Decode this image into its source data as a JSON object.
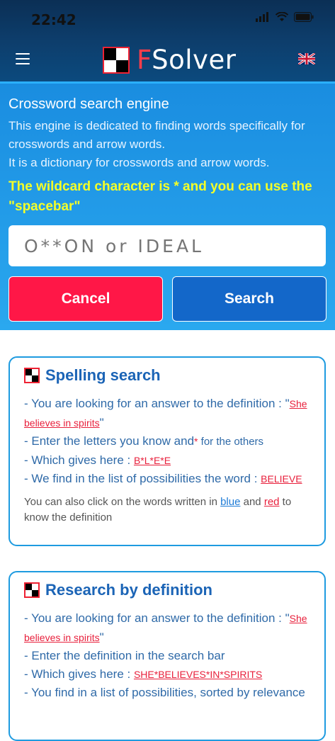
{
  "status_bar": {
    "time": "22:42"
  },
  "header": {
    "brand_first": "F",
    "brand_rest": "Solver",
    "language_flag": "uk-flag-icon"
  },
  "hero": {
    "title": "Crossword search engine",
    "description_1": "This engine is dedicated to finding words specifically for crosswords and arrow words.",
    "description_2": "It is a dictionary for crosswords and arrow words.",
    "wildcard_note": "The wildcard character is * and you can use the \"spacebar\""
  },
  "search": {
    "placeholder": "O**ON or IDEAL",
    "value": ""
  },
  "buttons": {
    "cancel": "Cancel",
    "search": "Search"
  },
  "cards": {
    "spelling": {
      "title": "Spelling search",
      "line1_a": "- You are looking for an answer to the definition : \"",
      "line1_link": "She believes in spirits",
      "line1_b": "\"",
      "line2_a": "- Enter the letters you know and",
      "line2_star": "*",
      "line2_b": " for the others",
      "line3_a": "- Which gives here : ",
      "line3_link": "B*L*E*E",
      "line4_a": "- We find in the list of possibilities the word : ",
      "line4_link": "BELIEVE",
      "foot_a": "You can also click on the words written in ",
      "foot_blue": "blue",
      "foot_b": " and ",
      "foot_red": "red",
      "foot_c": " to know the definition"
    },
    "definition": {
      "title": "Research by definition",
      "line1_a": "- You are looking for an answer to the definition : \"",
      "line1_link": "She believes in spirits",
      "line1_b": "\"",
      "line2": "- Enter the definition in the search bar",
      "line3_a": "- Which gives here : ",
      "line3_link": "SHE*BELIEVES*IN*SPIRITS",
      "line4": "- You find in a list of possibilities, sorted by relevance"
    }
  },
  "colors": {
    "accent_red": "#ff1747",
    "accent_blue": "#1367c9",
    "wildcard_yellow": "#f4ff28"
  }
}
